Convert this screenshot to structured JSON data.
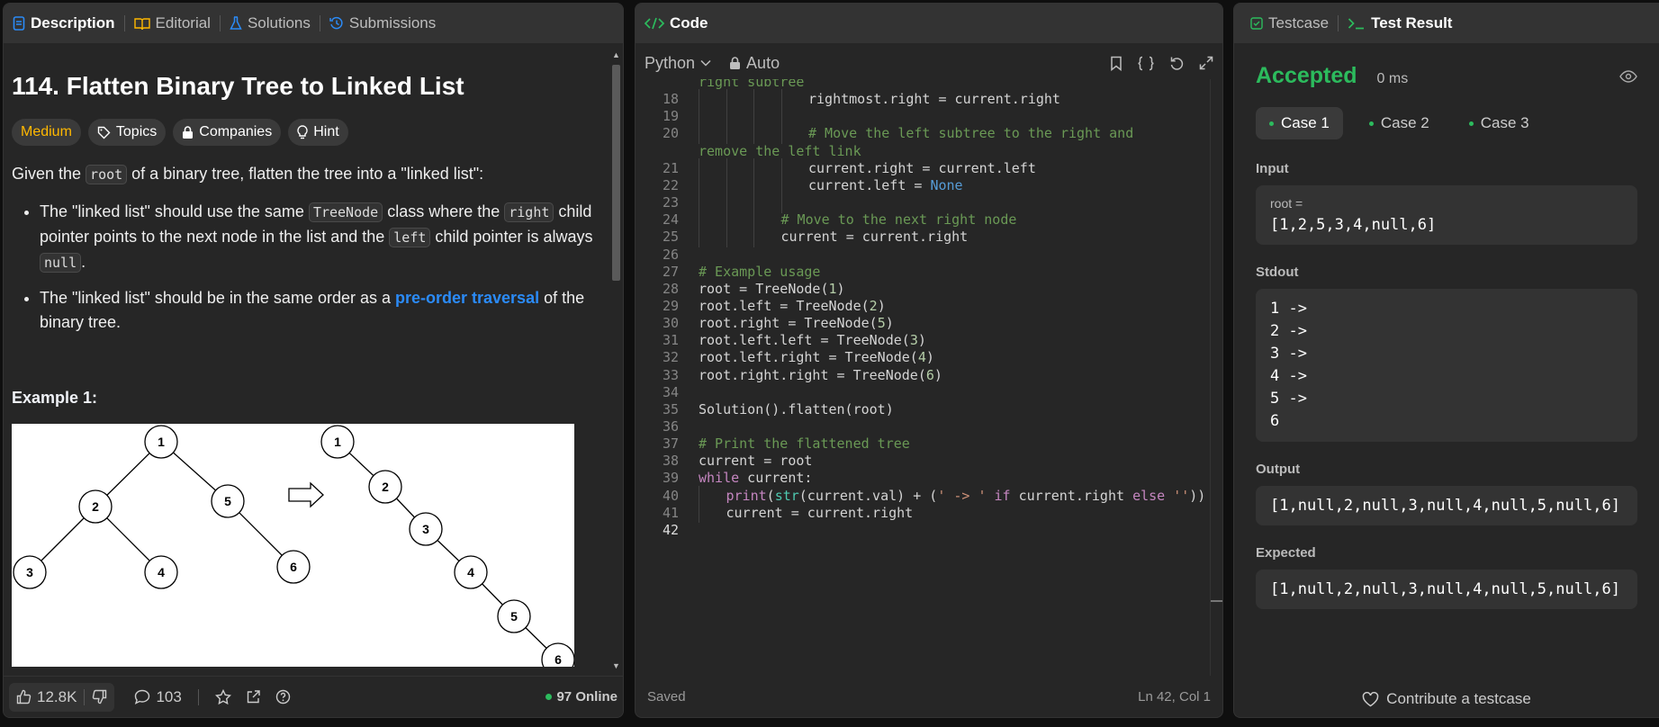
{
  "left": {
    "tabs": [
      "Description",
      "Editorial",
      "Solutions",
      "Submissions"
    ],
    "title": "114. Flatten Binary Tree to Linked List",
    "pills": {
      "difficulty": "Medium",
      "topics": "Topics",
      "companies": "Companies",
      "hint": "Hint"
    },
    "para1": {
      "a": "Given the ",
      "code": "root",
      "b": " of a binary tree, flatten the tree into a \"linked list\":"
    },
    "bullet1": {
      "a": "The \"linked list\" should use the same ",
      "code1": "TreeNode",
      "b": " class where the ",
      "code2": "right",
      "c": " child pointer points to the next node in the list and the ",
      "code3": "left",
      "d": " child pointer is always ",
      "code4": "null",
      "e": "."
    },
    "bullet2": {
      "a": "The \"linked list\" should be in the same order as a ",
      "link": "pre-order traversal",
      "b": " of the binary tree."
    },
    "example_heading": "Example 1:",
    "tree_left_nodes": [
      "1",
      "2",
      "5",
      "3",
      "4",
      "6"
    ],
    "tree_right_nodes": [
      "1",
      "2",
      "3",
      "4",
      "5",
      "6"
    ],
    "footer": {
      "likes": "12.8K",
      "comments": "103",
      "online": "97 Online"
    }
  },
  "code": {
    "tab": "Code",
    "language": "Python",
    "auto": "Auto",
    "saved": "Saved",
    "cursor": "Ln 42, Col 1",
    "partial_top": "right subtree"
  },
  "result": {
    "tabs": [
      "Testcase",
      "Test Result"
    ],
    "status": "Accepted",
    "runtime": "0 ms",
    "cases": [
      "Case 1",
      "Case 2",
      "Case 3"
    ],
    "input_label": "Input",
    "input_var": "root =",
    "input_value": "[1,2,5,3,4,null,6]",
    "stdout_label": "Stdout",
    "stdout": [
      "1 ->",
      "2 ->",
      "3 ->",
      "4 ->",
      "5 ->",
      "6"
    ],
    "output_label": "Output",
    "output_value": "[1,null,2,null,3,null,4,null,5,null,6]",
    "expected_label": "Expected",
    "expected_value": "[1,null,2,null,3,null,4,null,5,null,6]",
    "contribute": "Contribute a testcase"
  },
  "colors": {
    "accent_green": "#2cbb5d",
    "medium": "#ffb800",
    "link": "#2b8bf7"
  }
}
